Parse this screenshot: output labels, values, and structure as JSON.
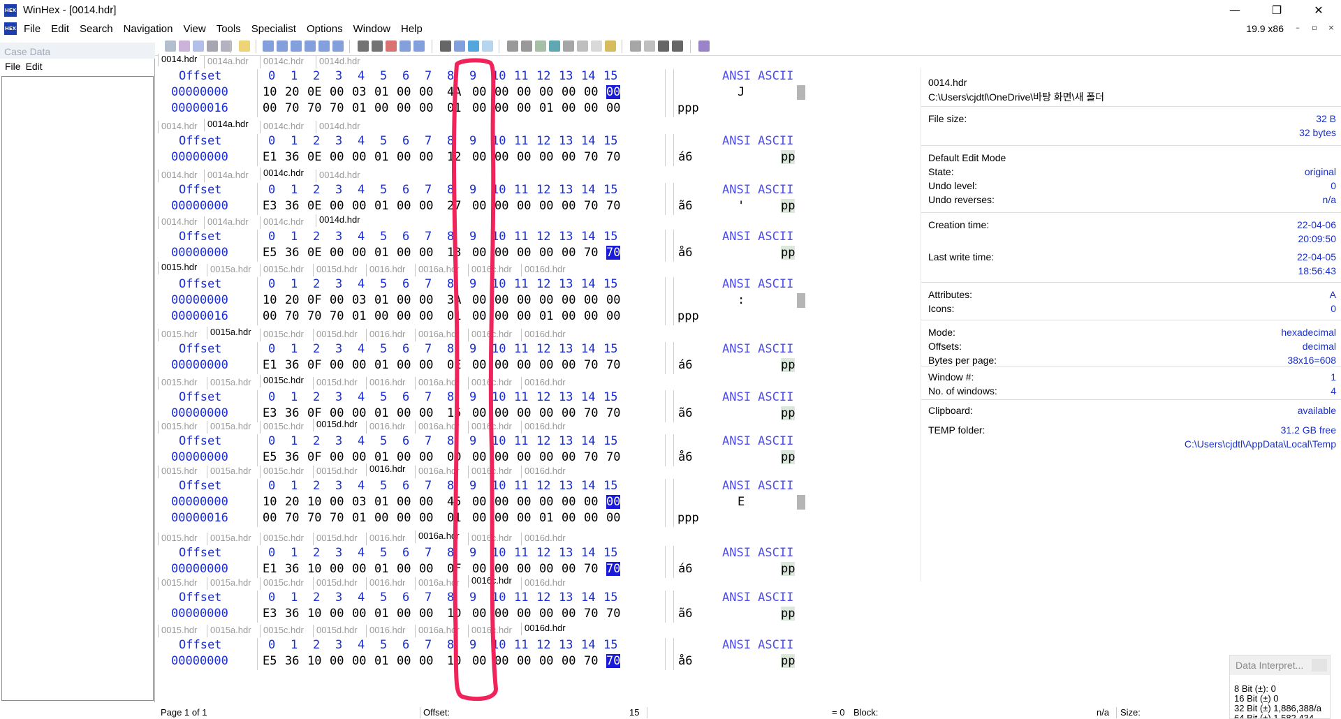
{
  "window": {
    "title": "WinHex - [0014.hdr]",
    "app_icon": "winhex-icon",
    "version": "19.9 x86",
    "minimize": "—",
    "restore": "❐",
    "close": "✕",
    "mdi_minimize": "–",
    "mdi_restore": "▫",
    "mdi_close": "×"
  },
  "menu": [
    "File",
    "Edit",
    "Search",
    "Navigation",
    "View",
    "Tools",
    "Specialist",
    "Options",
    "Window",
    "Help"
  ],
  "case_panel": {
    "title": "Case Data",
    "menu": [
      "File",
      "Edit"
    ]
  },
  "hex_windows": [
    {
      "tabs": [
        "0014.hdr",
        "0014a.hdr",
        "0014c.hdr",
        "0014d.hdr"
      ],
      "active": 0,
      "header": {
        "offset": "Offset",
        "cols": [
          "0",
          "1",
          "2",
          "3",
          "4",
          "5",
          "6",
          "7",
          "8",
          "9",
          "10",
          "11",
          "12",
          "13",
          "14",
          "15"
        ],
        "ansi": "ANSI ASCII"
      },
      "rows": [
        {
          "offset": "00000000",
          "bytes": [
            "10",
            "20",
            "0E",
            "00",
            "03",
            "01",
            "00",
            "00",
            "4A",
            "00",
            "00",
            "00",
            "00",
            "00",
            "00",
            "00"
          ],
          "ansi": "J",
          "cur": 15
        },
        {
          "offset": "00000016",
          "bytes": [
            "00",
            "70",
            "70",
            "70",
            "01",
            "00",
            "00",
            "00",
            "01",
            "00",
            "00",
            "00",
            "01",
            "00",
            "00",
            "00"
          ],
          "ansi": "ppp",
          "cur": -1
        }
      ]
    },
    {
      "tabs": [
        "0014.hdr",
        "0014a.hdr",
        "0014c.hdr",
        "0014d.hdr"
      ],
      "active": 1,
      "header": {
        "offset": "Offset",
        "cols": [
          "0",
          "1",
          "2",
          "3",
          "4",
          "5",
          "6",
          "7",
          "8",
          "9",
          "10",
          "11",
          "12",
          "13",
          "14",
          "15"
        ],
        "ansi": "ANSI ASCII"
      },
      "rows": [
        {
          "offset": "00000000",
          "bytes": [
            "E1",
            "36",
            "0E",
            "00",
            "00",
            "01",
            "00",
            "00",
            "12",
            "00",
            "00",
            "00",
            "00",
            "00",
            "70",
            "70"
          ],
          "ansi": "á6",
          "ansi_right": "pp",
          "cur": -1
        }
      ]
    },
    {
      "tabs": [
        "0014.hdr",
        "0014a.hdr",
        "0014c.hdr",
        "0014d.hdr"
      ],
      "active": 2,
      "header": {
        "offset": "Offset",
        "cols": [
          "0",
          "1",
          "2",
          "3",
          "4",
          "5",
          "6",
          "7",
          "8",
          "9",
          "10",
          "11",
          "12",
          "13",
          "14",
          "15"
        ],
        "ansi": "ANSI ASCII"
      },
      "rows": [
        {
          "offset": "00000000",
          "bytes": [
            "E3",
            "36",
            "0E",
            "00",
            "00",
            "01",
            "00",
            "00",
            "27",
            "00",
            "00",
            "00",
            "00",
            "00",
            "70",
            "70"
          ],
          "ansi": "ã6",
          "ansi_mid": "'",
          "ansi_right": "pp",
          "cur": -1
        }
      ]
    },
    {
      "tabs": [
        "0014.hdr",
        "0014a.hdr",
        "0014c.hdr",
        "0014d.hdr"
      ],
      "active": 3,
      "header": {
        "offset": "Offset",
        "cols": [
          "0",
          "1",
          "2",
          "3",
          "4",
          "5",
          "6",
          "7",
          "8",
          "9",
          "10",
          "11",
          "12",
          "13",
          "14",
          "15"
        ],
        "ansi": "ANSI ASCII"
      },
      "rows": [
        {
          "offset": "00000000",
          "bytes": [
            "E5",
            "36",
            "0E",
            "00",
            "00",
            "01",
            "00",
            "00",
            "13",
            "00",
            "00",
            "00",
            "00",
            "00",
            "70",
            "70"
          ],
          "ansi": "å6",
          "ansi_right": "pp",
          "cur": 15
        }
      ]
    },
    {
      "tabs": [
        "0015.hdr",
        "0015a.hdr",
        "0015c.hdr",
        "0015d.hdr",
        "0016.hdr",
        "0016a.hdr",
        "0016c.hdr",
        "0016d.hdr"
      ],
      "active": 0,
      "header": {
        "offset": "Offset",
        "cols": [
          "0",
          "1",
          "2",
          "3",
          "4",
          "5",
          "6",
          "7",
          "8",
          "9",
          "10",
          "11",
          "12",
          "13",
          "14",
          "15"
        ],
        "ansi": "ANSI ASCII"
      },
      "rows": [
        {
          "offset": "00000000",
          "bytes": [
            "10",
            "20",
            "0F",
            "00",
            "03",
            "01",
            "00",
            "00",
            "3A",
            "00",
            "00",
            "00",
            "00",
            "00",
            "00",
            "00"
          ],
          "ansi": ":",
          "cur": -1
        },
        {
          "offset": "00000016",
          "bytes": [
            "00",
            "70",
            "70",
            "70",
            "01",
            "00",
            "00",
            "00",
            "01",
            "00",
            "00",
            "00",
            "01",
            "00",
            "00",
            "00"
          ],
          "ansi": "ppp",
          "cur": -1
        }
      ]
    },
    {
      "tabs": [
        "0015.hdr",
        "0015a.hdr",
        "0015c.hdr",
        "0015d.hdr",
        "0016.hdr",
        "0016a.hdr",
        "0016c.hdr",
        "0016d.hdr"
      ],
      "active": 1,
      "header": {
        "offset": "Offset",
        "cols": [
          "0",
          "1",
          "2",
          "3",
          "4",
          "5",
          "6",
          "7",
          "8",
          "9",
          "10",
          "11",
          "12",
          "13",
          "14",
          "15"
        ],
        "ansi": "ANSI ASCII"
      },
      "rows": [
        {
          "offset": "00000000",
          "bytes": [
            "E1",
            "36",
            "0F",
            "00",
            "00",
            "01",
            "00",
            "00",
            "0E",
            "00",
            "00",
            "00",
            "00",
            "00",
            "70",
            "70"
          ],
          "ansi": "á6",
          "ansi_right": "pp",
          "cur": -1
        }
      ]
    },
    {
      "tabs": [
        "0015.hdr",
        "0015a.hdr",
        "0015c.hdr",
        "0015d.hdr",
        "0016.hdr",
        "0016a.hdr",
        "0016c.hdr",
        "0016d.hdr"
      ],
      "active": 2,
      "header": {
        "offset": "Offset",
        "cols": [
          "0",
          "1",
          "2",
          "3",
          "4",
          "5",
          "6",
          "7",
          "8",
          "9",
          "10",
          "11",
          "12",
          "13",
          "14",
          "15"
        ],
        "ansi": "ANSI ASCII"
      },
      "rows": [
        {
          "offset": "00000000",
          "bytes": [
            "E3",
            "36",
            "0F",
            "00",
            "00",
            "01",
            "00",
            "00",
            "15",
            "00",
            "00",
            "00",
            "00",
            "00",
            "70",
            "70"
          ],
          "ansi": "ã6",
          "ansi_right": "pp",
          "cur": -1
        }
      ]
    },
    {
      "tabs": [
        "0015.hdr",
        "0015a.hdr",
        "0015c.hdr",
        "0015d.hdr",
        "0016.hdr",
        "0016a.hdr",
        "0016c.hdr",
        "0016d.hdr"
      ],
      "active": 3,
      "header": {
        "offset": "Offset",
        "cols": [
          "0",
          "1",
          "2",
          "3",
          "4",
          "5",
          "6",
          "7",
          "8",
          "9",
          "10",
          "11",
          "12",
          "13",
          "14",
          "15"
        ],
        "ansi": "ANSI ASCII"
      },
      "rows": [
        {
          "offset": "00000000",
          "bytes": [
            "E5",
            "36",
            "0F",
            "00",
            "00",
            "01",
            "00",
            "00",
            "0D",
            "00",
            "00",
            "00",
            "00",
            "00",
            "70",
            "70"
          ],
          "ansi": "å6",
          "ansi_right": "pp",
          "cur": -1
        }
      ]
    },
    {
      "tabs": [
        "0015.hdr",
        "0015a.hdr",
        "0015c.hdr",
        "0015d.hdr",
        "0016.hdr",
        "0016a.hdr",
        "0016c.hdr",
        "0016d.hdr"
      ],
      "active": 4,
      "header": {
        "offset": "Offset",
        "cols": [
          "0",
          "1",
          "2",
          "3",
          "4",
          "5",
          "6",
          "7",
          "8",
          "9",
          "10",
          "11",
          "12",
          "13",
          "14",
          "15"
        ],
        "ansi": "ANSI ASCII"
      },
      "rows": [
        {
          "offset": "00000000",
          "bytes": [
            "10",
            "20",
            "10",
            "00",
            "03",
            "01",
            "00",
            "00",
            "45",
            "00",
            "00",
            "00",
            "00",
            "00",
            "00",
            "00"
          ],
          "ansi": "E",
          "cur": 15
        },
        {
          "offset": "00000016",
          "bytes": [
            "00",
            "70",
            "70",
            "70",
            "01",
            "00",
            "00",
            "00",
            "01",
            "00",
            "00",
            "00",
            "01",
            "00",
            "00",
            "00"
          ],
          "ansi": "ppp",
          "cur": -1
        }
      ]
    },
    {
      "tabs": [
        "0015.hdr",
        "0015a.hdr",
        "0015c.hdr",
        "0015d.hdr",
        "0016.hdr",
        "0016a.hdr",
        "0016c.hdr",
        "0016d.hdr"
      ],
      "active": 5,
      "header": {
        "offset": "Offset",
        "cols": [
          "0",
          "1",
          "2",
          "3",
          "4",
          "5",
          "6",
          "7",
          "8",
          "9",
          "10",
          "11",
          "12",
          "13",
          "14",
          "15"
        ],
        "ansi": "ANSI ASCII"
      },
      "rows": [
        {
          "offset": "00000000",
          "bytes": [
            "E1",
            "36",
            "10",
            "00",
            "00",
            "01",
            "00",
            "00",
            "0F",
            "00",
            "00",
            "00",
            "00",
            "00",
            "70",
            "70"
          ],
          "ansi": "á6",
          "ansi_right": "pp",
          "cur": 15
        }
      ]
    },
    {
      "tabs": [
        "0015.hdr",
        "0015a.hdr",
        "0015c.hdr",
        "0015d.hdr",
        "0016.hdr",
        "0016a.hdr",
        "0016c.hdr",
        "0016d.hdr"
      ],
      "active": 6,
      "header": {
        "offset": "Offset",
        "cols": [
          "0",
          "1",
          "2",
          "3",
          "4",
          "5",
          "6",
          "7",
          "8",
          "9",
          "10",
          "11",
          "12",
          "13",
          "14",
          "15"
        ],
        "ansi": "ANSI ASCII"
      },
      "rows": [
        {
          "offset": "00000000",
          "bytes": [
            "E3",
            "36",
            "10",
            "00",
            "00",
            "01",
            "00",
            "00",
            "1D",
            "00",
            "00",
            "00",
            "00",
            "00",
            "70",
            "70"
          ],
          "ansi": "ã6",
          "ansi_right": "pp",
          "cur": -1
        }
      ]
    },
    {
      "tabs": [
        "0015.hdr",
        "0015a.hdr",
        "0015c.hdr",
        "0015d.hdr",
        "0016.hdr",
        "0016a.hdr",
        "0016c.hdr",
        "0016d.hdr"
      ],
      "active": 7,
      "header": {
        "offset": "Offset",
        "cols": [
          "0",
          "1",
          "2",
          "3",
          "4",
          "5",
          "6",
          "7",
          "8",
          "9",
          "10",
          "11",
          "12",
          "13",
          "14",
          "15"
        ],
        "ansi": "ANSI ASCII"
      },
      "rows": [
        {
          "offset": "00000000",
          "bytes": [
            "E5",
            "36",
            "10",
            "00",
            "00",
            "01",
            "00",
            "00",
            "10",
            "00",
            "00",
            "00",
            "00",
            "00",
            "70",
            "70"
          ],
          "ansi": "å6",
          "ansi_right": "pp",
          "cur": 15
        }
      ]
    }
  ],
  "info_panel": {
    "filename": "0014.hdr",
    "path": "C:\\Users\\cjdtl\\OneDrive\\바탕 화면\\새 폴더",
    "rows": [
      {
        "label": "File size:",
        "value": "32 B"
      },
      {
        "label": "",
        "value": "32 bytes"
      },
      {
        "label": "Default Edit Mode",
        "value": ""
      },
      {
        "label": "State:",
        "value": "original"
      },
      {
        "label": "Undo level:",
        "value": "0"
      },
      {
        "label": "Undo reverses:",
        "value": "n/a"
      },
      {
        "label": "Creation time:",
        "value": "22-04-06"
      },
      {
        "label": "",
        "value": "20:09:50"
      },
      {
        "label": "Last write time:",
        "value": "22-04-05"
      },
      {
        "label": "",
        "value": "18:56:43"
      },
      {
        "label": "Attributes:",
        "value": "A"
      },
      {
        "label": "Icons:",
        "value": "0"
      },
      {
        "label": "Mode:",
        "value": "hexadecimal"
      },
      {
        "label": "Offsets:",
        "value": "decimal"
      },
      {
        "label": "Bytes per page:",
        "value": "38x16=608"
      },
      {
        "label": "Window #:",
        "value": "1"
      },
      {
        "label": "No. of windows:",
        "value": "4"
      },
      {
        "label": "Clipboard:",
        "value": "available"
      },
      {
        "label": "TEMP folder:",
        "value": "31.2 GB free"
      },
      {
        "label": "",
        "value": "C:\\Users\\cjdtl\\AppData\\Local\\Temp"
      }
    ]
  },
  "data_interpreter": {
    "title": "Data Interpret...",
    "lines": [
      "8 Bit (±): 0",
      "16 Bit (±) 0",
      "32 Bit (±) 1,886,388/a",
      "64 Bit (±) 1,582,434"
    ]
  },
  "statusbar": {
    "page": "Page 1 of 1",
    "offset_label": "Offset:",
    "offset_value": "15",
    "eq": "= 0",
    "block_label": "Block:",
    "block_value": "n/a",
    "size_label": "Size:"
  },
  "colors": {
    "hex_blue": "#1a2edb",
    "cursor": "#1a1ad9",
    "annotation_red": "#f0245a"
  }
}
